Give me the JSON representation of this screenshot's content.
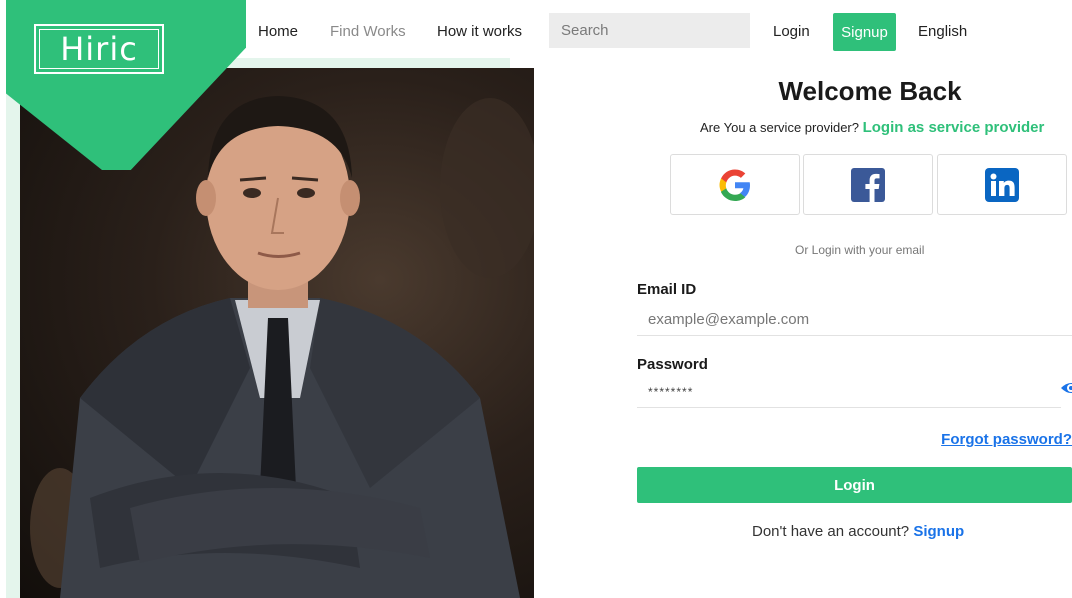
{
  "brand": {
    "logo_text": "Hiric",
    "accent": "#2fc07a",
    "link_color": "#1a73e8"
  },
  "nav": {
    "home": "Home",
    "find_works": "Find Works",
    "how_it_works": "How it works",
    "search_placeholder": "Search",
    "login": "Login",
    "signup": "Signup",
    "language": "English"
  },
  "hero": {
    "image_alt": "businessman-portrait"
  },
  "form": {
    "title": "Welcome Back",
    "provider_prompt": "Are You a service provider?",
    "provider_link": "Login as service provider",
    "social": [
      {
        "name": "google",
        "icon": "google-icon"
      },
      {
        "name": "facebook",
        "icon": "facebook-icon"
      },
      {
        "name": "linkedin",
        "icon": "linkedin-icon"
      }
    ],
    "or_text": "Or Login with your email",
    "email_label": "Email ID",
    "email_placeholder": "example@example.com",
    "password_label": "Password",
    "password_value": "********",
    "forgot": "Forgot password?",
    "login_button": "Login",
    "no_account": "Don't have an account?",
    "signup_link": "Signup"
  }
}
